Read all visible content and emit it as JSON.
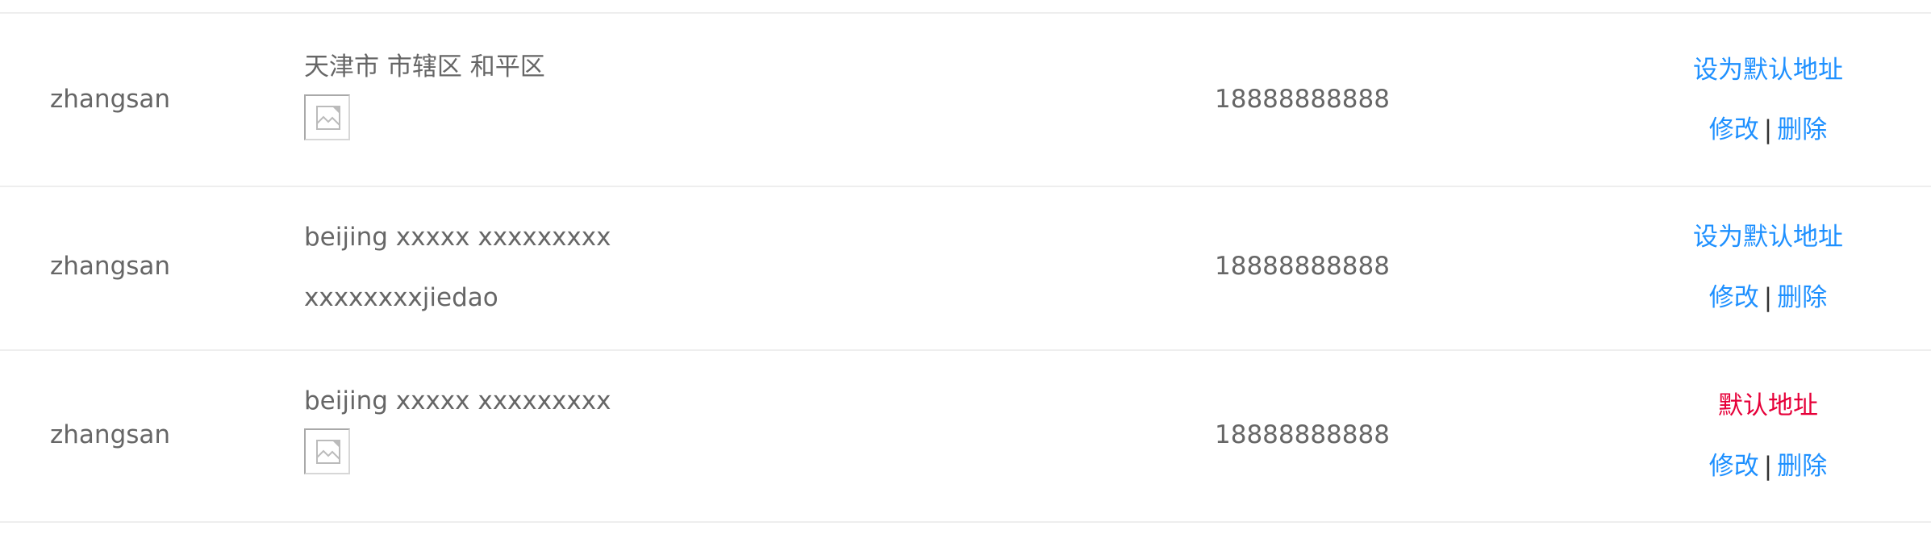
{
  "addresses": [
    {
      "name": "zhangsan",
      "address_line1": "天津市 市辖区 和平区",
      "address_line2": "",
      "has_image": true,
      "phone": "18888888888",
      "set_default_label": "设为默认地址",
      "is_default": false,
      "edit_label": "修改",
      "separator": "|",
      "delete_label": "删除"
    },
    {
      "name": "zhangsan",
      "address_line1": "beijing xxxxx xxxxxxxxx",
      "address_line2": "xxxxxxxxjiedao",
      "has_image": false,
      "phone": "18888888888",
      "set_default_label": "设为默认地址",
      "is_default": false,
      "edit_label": "修改",
      "separator": "|",
      "delete_label": "删除"
    },
    {
      "name": "zhangsan",
      "address_line1": "beijing xxxxx xxxxxxxxx",
      "address_line2": "",
      "has_image": true,
      "phone": "18888888888",
      "default_label": "默认地址",
      "is_default": true,
      "edit_label": "修改",
      "separator": "|",
      "delete_label": "删除"
    }
  ],
  "colors": {
    "text": "#666666",
    "link": "#1e90ff",
    "default": "#e60039",
    "divider": "#eeeeee"
  },
  "icons": {
    "broken_image": "broken-image-icon"
  }
}
